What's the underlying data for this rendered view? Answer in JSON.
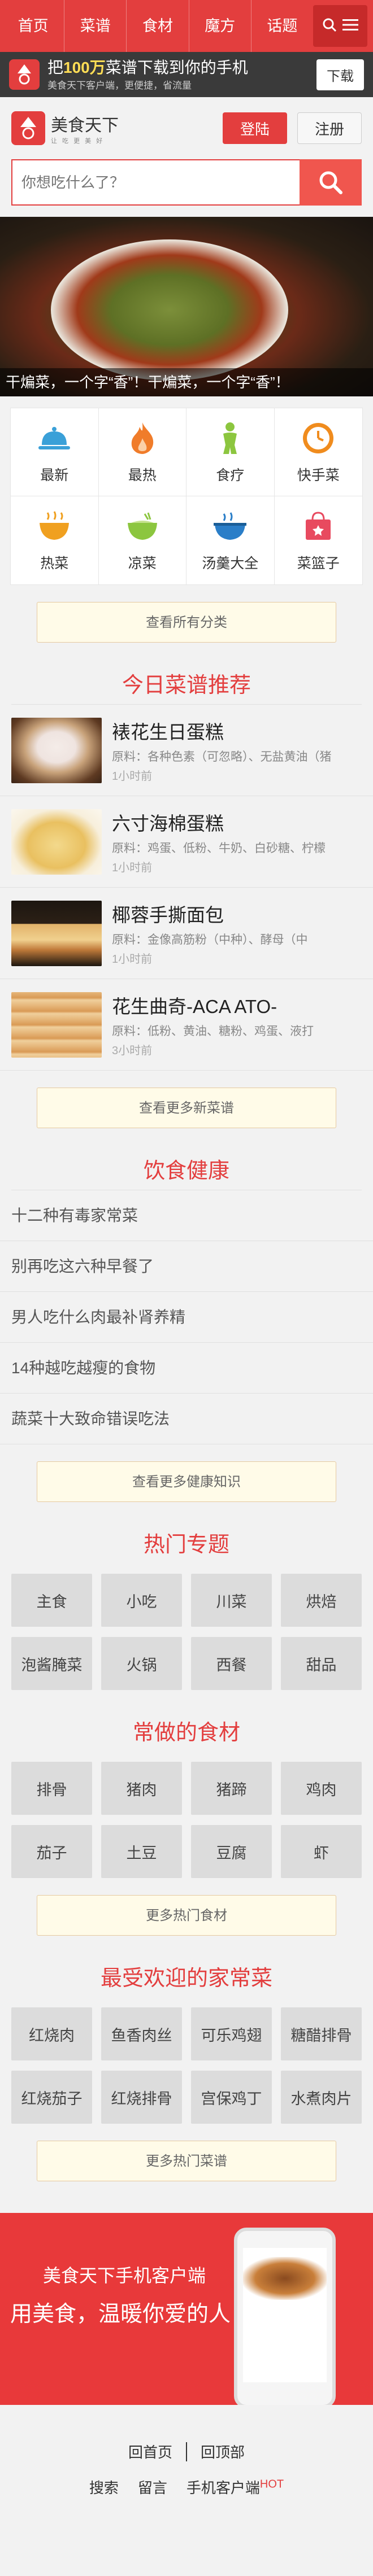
{
  "nav": {
    "items": [
      "首页",
      "菜谱",
      "食材",
      "魔方",
      "话题"
    ]
  },
  "appbar": {
    "main_prefix": "把",
    "main_bold": "100万",
    "main_suffix": "菜谱下载到你的手机",
    "sub": "美食天下客户端，更便捷，省流量",
    "download": "下载"
  },
  "brand": {
    "name": "美食天下",
    "slogan": "让 吃 更 美 好",
    "login": "登陆",
    "register": "注册"
  },
  "search": {
    "placeholder": "你想吃什么了？"
  },
  "hero": {
    "caption": "干煸菜，一个字“香”！干煸菜，一个字“香”！"
  },
  "categories": [
    {
      "label": "最新",
      "icon": "cloche-icon",
      "color": "#3aa0d8"
    },
    {
      "label": "最热",
      "icon": "flame-icon",
      "color": "#f07c2a"
    },
    {
      "label": "食疗",
      "icon": "figure-icon",
      "color": "#8cc63f"
    },
    {
      "label": "快手菜",
      "icon": "clock-icon",
      "color": "#f08c1e"
    },
    {
      "label": "热菜",
      "icon": "hot-bowl-icon",
      "color": "#f0a020"
    },
    {
      "label": "凉菜",
      "icon": "cold-bowl-icon",
      "color": "#8cc63f"
    },
    {
      "label": "汤羹大全",
      "icon": "soup-icon",
      "color": "#2a7ec8"
    },
    {
      "label": "菜篮子",
      "icon": "basket-icon",
      "color": "#e84a5f"
    }
  ],
  "more_categories": "查看所有分类",
  "today": {
    "title": "今日菜谱推荐",
    "recipes": [
      {
        "title": "裱花生日蛋糕",
        "desc": "原料：各种色素（可忽略）、无盐黄油（猪",
        "time": "1小时前"
      },
      {
        "title": "六寸海棉蛋糕",
        "desc": "原料：鸡蛋、低粉、牛奶、白砂糖、柠檬",
        "time": "1小时前"
      },
      {
        "title": "椰蓉手撕面包",
        "desc": "原料：金像高筋粉（中种）、酵母（中",
        "time": "1小时前"
      },
      {
        "title": "花生曲奇-ACA ATO-",
        "desc": "原料：低粉、黄油、糖粉、鸡蛋、液打",
        "time": "3小时前"
      }
    ],
    "more": "查看更多新菜谱"
  },
  "health": {
    "title": "饮食健康",
    "items": [
      "十二种有毒家常菜",
      "别再吃这六种早餐了",
      "男人吃什么肉最补肾养精",
      "14种越吃越瘦的食物",
      "蔬菜十大致命错误吃法"
    ],
    "more": "查看更多健康知识"
  },
  "topics": {
    "title": "热门专题",
    "tags": [
      "主食",
      "小吃",
      "川菜",
      "烘焙",
      "泡酱腌菜",
      "火锅",
      "西餐",
      "甜品"
    ]
  },
  "ingredients": {
    "title": "常做的食材",
    "tags": [
      "排骨",
      "猪肉",
      "猪蹄",
      "鸡肉",
      "茄子",
      "土豆",
      "豆腐",
      "虾"
    ],
    "more": "更多热门食材"
  },
  "homestyle": {
    "title": "最受欢迎的家常菜",
    "tags": [
      "红烧肉",
      "鱼香肉丝",
      "可乐鸡翅",
      "糖醋排骨",
      "红烧茄子",
      "红烧排骨",
      "宫保鸡丁",
      "水煮肉片"
    ],
    "more": "更多热门菜谱"
  },
  "promo": {
    "line1": "美食天下手机客户端",
    "line2": "用美食，温暖你爱的人"
  },
  "footer": {
    "home": "回首页",
    "top": "回顶部",
    "links": [
      "搜索",
      "留言",
      "手机客户端"
    ],
    "hot": "HOT"
  }
}
